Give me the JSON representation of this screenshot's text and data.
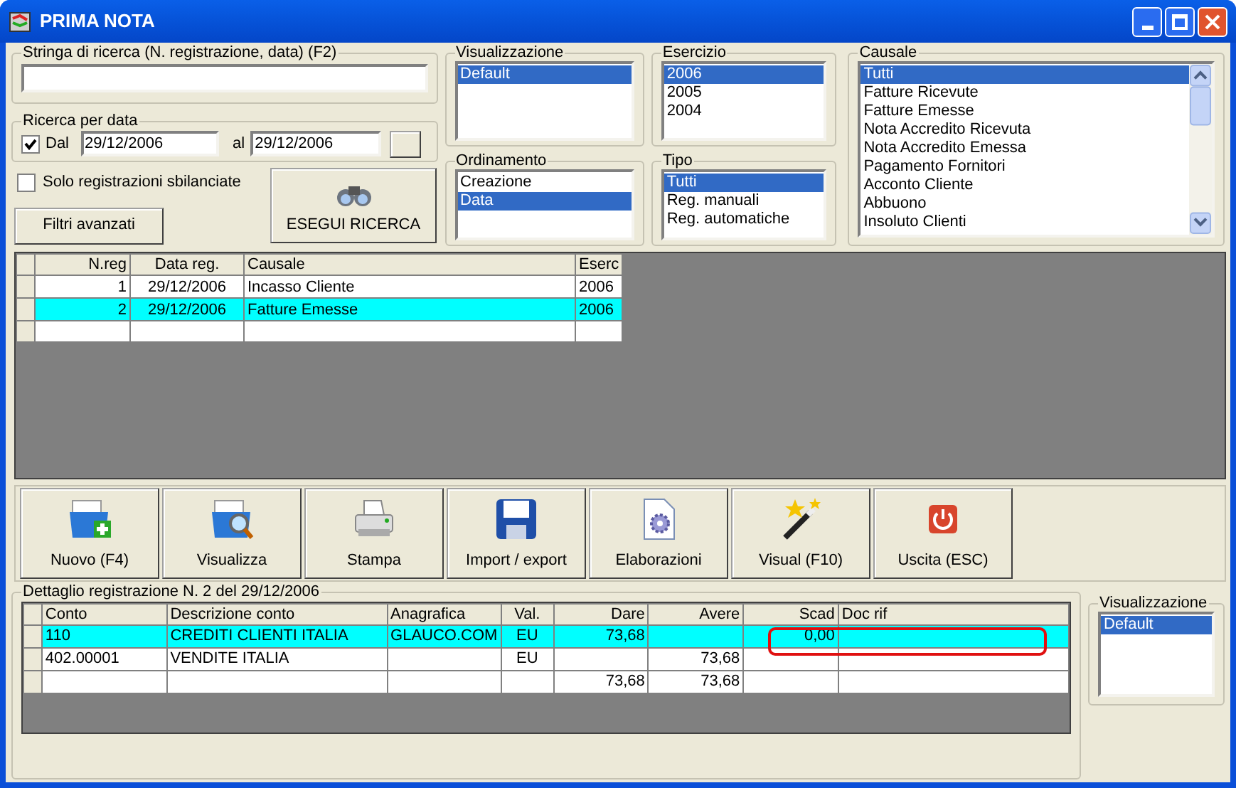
{
  "window": {
    "title": "PRIMA NOTA"
  },
  "search": {
    "label": "Stringa di ricerca (N. registrazione, data) (F2)"
  },
  "date_search": {
    "label": "Ricerca per data",
    "checkbox_label": "Dal",
    "checked": true,
    "from": "29/12/2006",
    "to_label": "al",
    "to": "29/12/2006"
  },
  "unbalanced_only": {
    "label": "Solo registrazioni sbilanciate",
    "checked": false
  },
  "advanced_filters": "Filtri avanzati",
  "run_search": "ESEGUI RICERCA",
  "visualizzazione": {
    "title": "Visualizzazione",
    "items": [
      {
        "label": "Default",
        "selected": true
      }
    ]
  },
  "ordinamento": {
    "title": "Ordinamento",
    "items": [
      {
        "label": "Creazione",
        "selected": false
      },
      {
        "label": "Data",
        "selected": true
      }
    ]
  },
  "esercizio": {
    "title": "Esercizio",
    "items": [
      {
        "label": "2006",
        "selected": true
      },
      {
        "label": "2005",
        "selected": false
      },
      {
        "label": "2004",
        "selected": false
      }
    ]
  },
  "tipo": {
    "title": "Tipo",
    "items": [
      {
        "label": "Tutti",
        "selected": true
      },
      {
        "label": "Reg. manuali",
        "selected": false
      },
      {
        "label": "Reg. automatiche",
        "selected": false
      }
    ]
  },
  "causale": {
    "title": "Causale",
    "items": [
      {
        "label": "Tutti",
        "selected": true
      },
      {
        "label": "Fatture Ricevute",
        "selected": false
      },
      {
        "label": "Fatture Emesse",
        "selected": false
      },
      {
        "label": "Nota Accredito Ricevuta",
        "selected": false
      },
      {
        "label": "Nota Accredito Emessa",
        "selected": false
      },
      {
        "label": "Pagamento Fornitori",
        "selected": false
      },
      {
        "label": "Acconto Cliente",
        "selected": false
      },
      {
        "label": "Abbuono",
        "selected": false
      },
      {
        "label": "Insoluto Clienti",
        "selected": false
      }
    ]
  },
  "registrations": {
    "columns": [
      "N.reg",
      "Data reg.",
      "Causale",
      "Eserc"
    ],
    "rows": [
      {
        "cells": [
          "1",
          "29/12/2006",
          "Incasso Cliente",
          "2006"
        ],
        "selected": false
      },
      {
        "cells": [
          "2",
          "29/12/2006",
          "Fatture Emesse",
          "2006"
        ],
        "selected": true
      }
    ]
  },
  "toolbar": [
    {
      "label": "Nuovo (F4)",
      "kind": "new"
    },
    {
      "label": "Visualizza",
      "kind": "view"
    },
    {
      "label": "Stampa",
      "kind": "print"
    },
    {
      "label": "Import / export",
      "kind": "save"
    },
    {
      "label": "Elaborazioni",
      "kind": "process"
    },
    {
      "label": "Visual (F10)",
      "kind": "wand"
    },
    {
      "label": "Uscita (ESC)",
      "kind": "exit"
    }
  ],
  "detail": {
    "title": "Dettaglio registrazione N. 2 del 29/12/2006",
    "columns": [
      "Conto",
      "Descrizione conto",
      "Anagrafica",
      "Val.",
      "Dare",
      "Avere",
      "Scad",
      "Doc rif"
    ],
    "rows": [
      {
        "cells": {
          "conto": "110",
          "descrizione": "CREDITI CLIENTI ITALIA",
          "anagrafica": "GLAUCO.COM",
          "val": "EU",
          "dare": "73,68",
          "scad": "0,00"
        },
        "selected": true
      },
      {
        "cells": {
          "conto": "402.00001",
          "descrizione": "VENDITE ITALIA",
          "val": "EU",
          "avere": "73,68"
        },
        "selected": false
      },
      {
        "cells": {
          "dare": "73,68",
          "avere": "73,68"
        },
        "selected": false
      }
    ]
  },
  "detail_view": {
    "title": "Visualizzazione",
    "items": [
      {
        "label": "Default",
        "selected": true
      }
    ]
  }
}
